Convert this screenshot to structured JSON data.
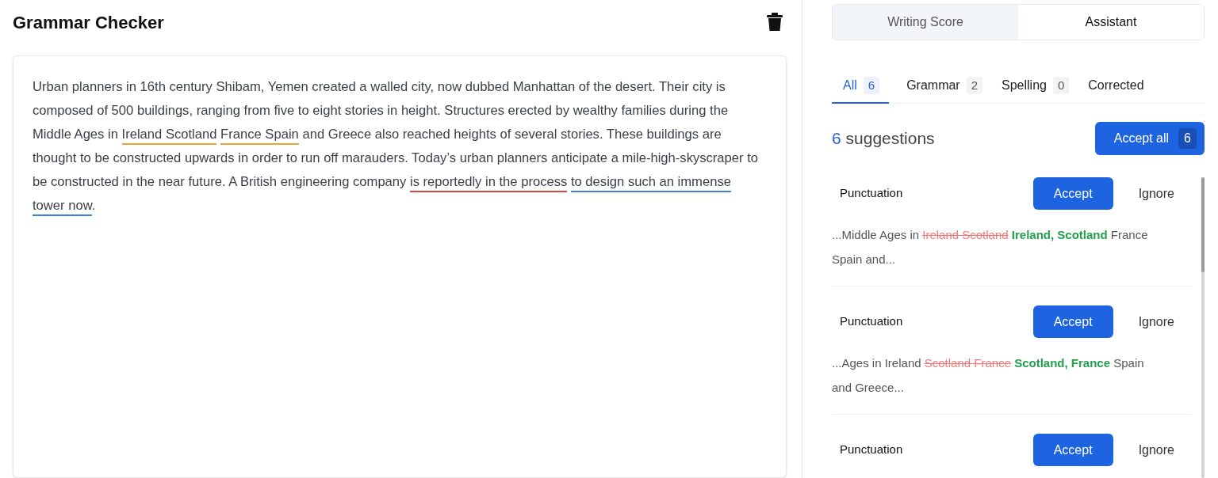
{
  "editor": {
    "title": "Grammar Checker",
    "text": [
      {
        "text": "Urban planners in 16th century Shibam, Yemen created a walled city, now dubbed Manhattan of the desert. Their city is composed of 500 buildings, ranging from five to eight stories in height. Structures erected by wealthy families during the Middle Ages in "
      },
      {
        "text": "Ireland Scotland",
        "color": "#e8a23a"
      },
      {
        "text": "France Spain",
        "color": "#e8a23a"
      },
      {
        "text": " and Greece also reached heights of several stories. These buildings are thought to be constructed upwards in order to run off marauders. Today’s urban planners anticipate a mile-high-skyscraper to be constructed in the near future. A British engineering company "
      },
      {
        "text": "is reportedly in the process",
        "color": "#e0433f"
      },
      {
        "text": "to design such an immense tower now",
        "color": "#3f7fd9"
      },
      {
        "text": "."
      }
    ]
  },
  "panel_tabs": [
    {
      "label": "Writing Score",
      "selected": false
    },
    {
      "label": "Assistant",
      "selected": true
    }
  ],
  "filter_tabs": [
    {
      "label": "All",
      "count": "6",
      "selected": true
    },
    {
      "label": "Grammar",
      "count": "2",
      "selected": false
    },
    {
      "label": "Spelling",
      "count": "0",
      "selected": false
    },
    {
      "label": "Corrected",
      "selected": false
    }
  ],
  "summary": {
    "count": "6",
    "label": "suggestions"
  },
  "accept_all": {
    "label": "Accept all",
    "count": "6"
  },
  "suggestions": [
    {
      "category": "Punctuation",
      "accept": "Accept",
      "ignore": "Ignore",
      "before": "...Middle Ages in",
      "removed": "Ireland Scotland",
      "added": "Ireland, Scotland",
      "after": "France Spain and..."
    },
    {
      "category": "Punctuation",
      "accept": "Accept",
      "ignore": "Ignore",
      "before": "...Ages in Ireland",
      "removed": "Scotland France",
      "added": "Scotland, France",
      "after": "Spain and Greece..."
    },
    {
      "category": "Punctuation",
      "accept": "Accept",
      "ignore": "Ignore"
    }
  ]
}
